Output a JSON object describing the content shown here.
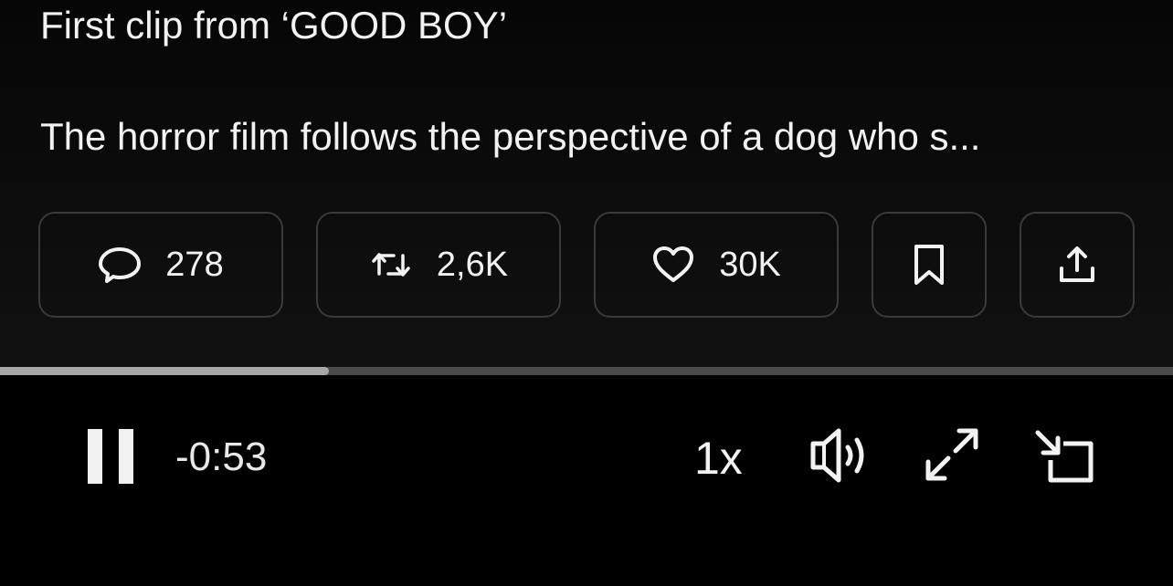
{
  "post": {
    "title": "First clip from ‘GOOD BOY’",
    "description": "The horror film follows the perspective of a dog who s..."
  },
  "actions": {
    "replies": {
      "icon": "reply-icon",
      "count": "278"
    },
    "reposts": {
      "icon": "repost-icon",
      "count": "2,6K"
    },
    "likes": {
      "icon": "heart-icon",
      "count": "30K"
    },
    "bookmark": {
      "icon": "bookmark-icon"
    },
    "share": {
      "icon": "share-icon"
    }
  },
  "player": {
    "progress_fraction": 0.28,
    "time_remaining": "-0:53",
    "playback_speed": "1x",
    "state_icon": "pause-icon",
    "volume_icon": "volume-icon",
    "fullscreen_icon": "fullscreen-icon",
    "pip_icon": "picture-in-picture-icon"
  },
  "colors": {
    "background": "#000000",
    "text": "#f2f2f2",
    "button_border": "#3a3a3a",
    "progress_track": "#4a4a4a",
    "progress_fill": "#a8a8a8"
  }
}
